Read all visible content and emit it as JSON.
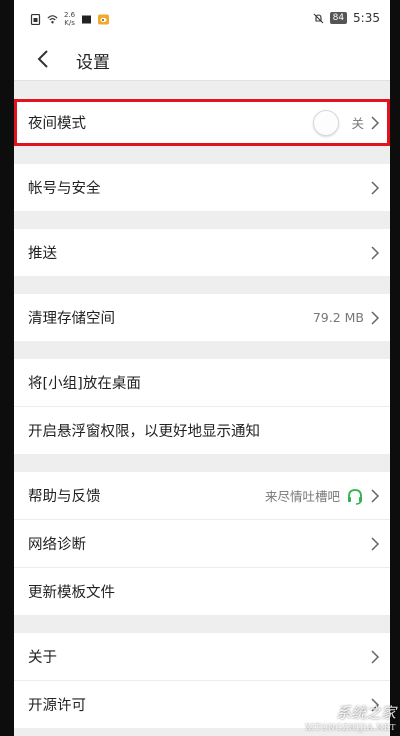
{
  "status_bar": {
    "net_speed_value": "2.6",
    "net_speed_unit": "K/s",
    "battery": "84",
    "time": "5:35"
  },
  "header": {
    "title": "设置"
  },
  "groups": [
    {
      "items": [
        {
          "label": "夜间模式",
          "value": "关"
        }
      ]
    },
    {
      "items": [
        {
          "label": "帐号与安全"
        }
      ]
    },
    {
      "items": [
        {
          "label": "推送"
        }
      ]
    },
    {
      "items": [
        {
          "label": "清理存储空间",
          "value": "79.2 MB"
        }
      ]
    },
    {
      "items": [
        {
          "label": "将[小组]放在桌面"
        },
        {
          "label": "开启悬浮窗权限，以更好地显示通知"
        }
      ]
    },
    {
      "items": [
        {
          "label": "帮助与反馈",
          "value": "来尽情吐槽吧"
        },
        {
          "label": "网络诊断"
        },
        {
          "label": "更新模板文件"
        }
      ]
    },
    {
      "items": [
        {
          "label": "关于"
        },
        {
          "label": "开源许可"
        }
      ]
    }
  ],
  "watermark": {
    "main": "系统之家",
    "sub": "XITONGZHIJIA.NET"
  },
  "colors": {
    "highlight": "#e0141e",
    "headset_green": "#2eb24e"
  }
}
